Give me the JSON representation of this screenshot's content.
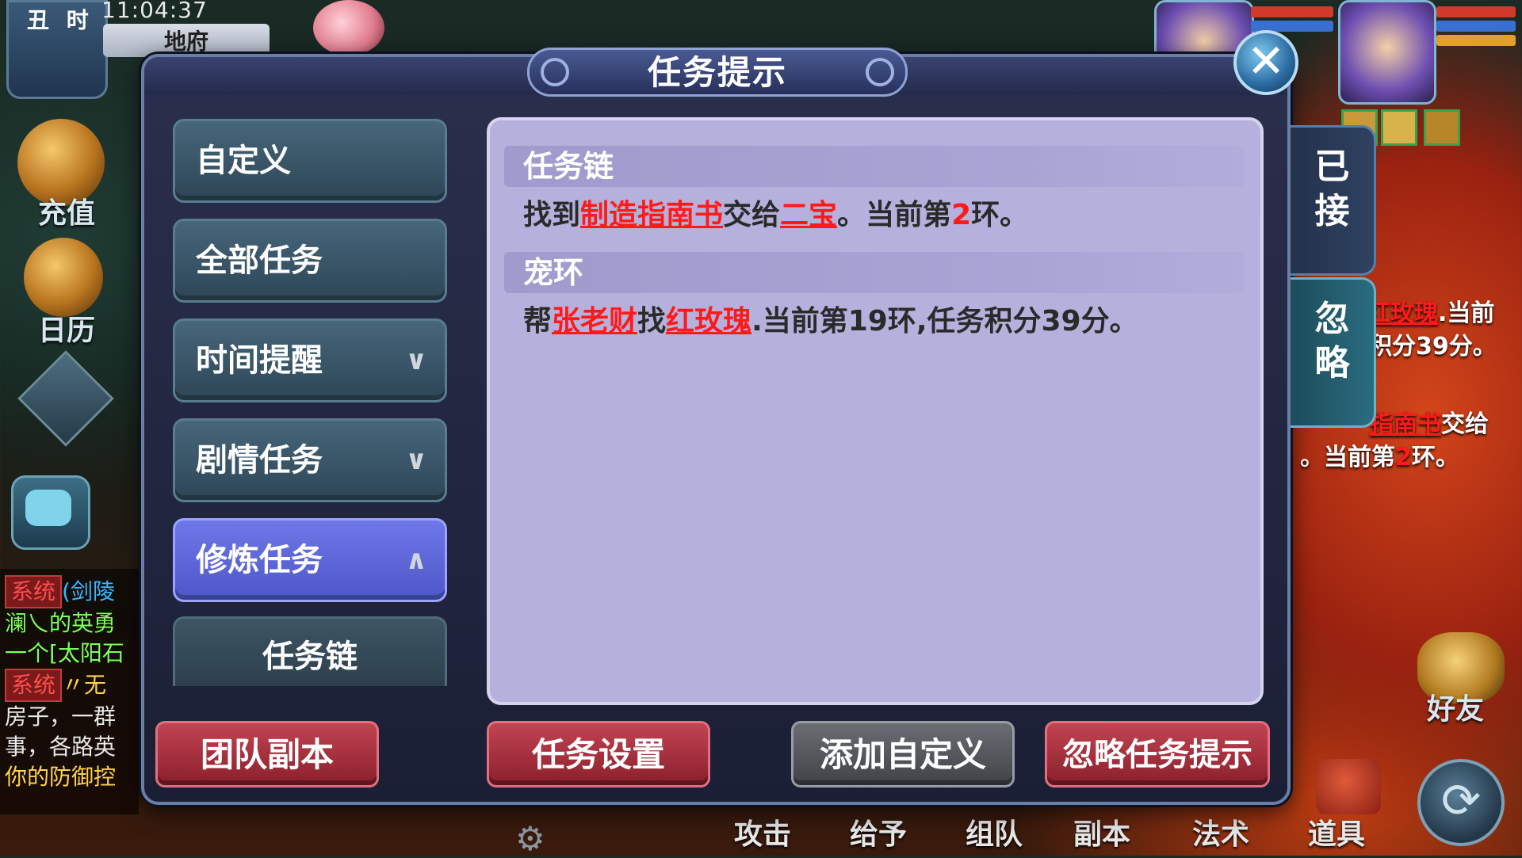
{
  "status": {
    "period": "丑 时",
    "time": "11:04:37",
    "map_name": "地府"
  },
  "left_menu": {
    "recharge": "充值",
    "calendar": "日历"
  },
  "chat": {
    "lines": [
      {
        "tag": "系统",
        "text": "(剑陵"
      },
      {
        "tag": "",
        "text": "澜乀的英勇"
      },
      {
        "tag": "",
        "text": "一个[太阳石"
      },
      {
        "tag": "系统",
        "text": "〃无"
      },
      {
        "tag": "",
        "text": "房子，一群"
      },
      {
        "tag": "",
        "text": "事，各路英"
      },
      {
        "tag": "",
        "text": "你的防御控"
      }
    ]
  },
  "dialog": {
    "title": "任务提示",
    "close_icon": "✕",
    "categories": [
      {
        "label": "自定义",
        "chevron": ""
      },
      {
        "label": "全部任务",
        "chevron": ""
      },
      {
        "label": "时间提醒",
        "chevron": "∨"
      },
      {
        "label": "剧情任务",
        "chevron": "∨"
      },
      {
        "label": "修炼任务",
        "chevron": "∧"
      }
    ],
    "subcategory": "任务链",
    "sections": [
      {
        "head": "任务链",
        "parts": [
          "找到",
          "制造指南书",
          "交给",
          "二宝",
          "。当前第",
          "2",
          "环。"
        ]
      },
      {
        "head": "宠环",
        "parts": [
          "帮",
          "张老财",
          "找",
          "红玫瑰",
          ".当前第19环,任务积分39分。"
        ]
      }
    ],
    "side_tabs": {
      "accepted_1": "已",
      "accepted_2": "接",
      "ignore_1": "忽",
      "ignore_2": "略"
    },
    "buttons": {
      "team_dungeon": "团队副本",
      "task_settings": "任务设置",
      "add_custom": "添加自定义",
      "ignore_prompt": "忽略任务提示"
    }
  },
  "background_tracker": {
    "line1": "红玫瑰",
    "line1b": ".当前",
    "line2": "积分39分。",
    "line3": "指南书",
    "line3b": "交给",
    "line4a": "。当前第",
    "line4b": "2",
    "line4c": "环。"
  },
  "bottom_bar": [
    "攻击",
    "给予",
    "组队",
    "副本",
    "法术",
    "道具"
  ],
  "friend_label": "好友"
}
